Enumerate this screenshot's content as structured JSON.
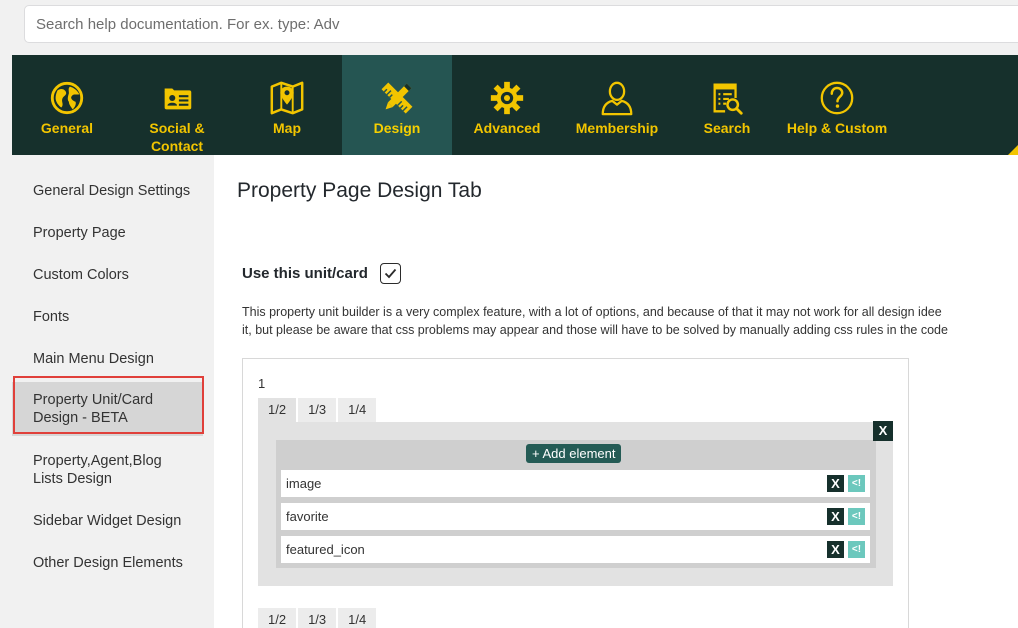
{
  "search": {
    "placeholder": "Search help documentation. For ex. type: Adv"
  },
  "nav": {
    "items": [
      {
        "label": "General",
        "icon": "globe-icon"
      },
      {
        "label": "Social &\nContact",
        "icon": "contact-card-icon"
      },
      {
        "label": "Map",
        "icon": "map-pin-icon"
      },
      {
        "label": "Design",
        "icon": "pencil-ruler-icon",
        "active": true
      },
      {
        "label": "Advanced",
        "icon": "gear-icon"
      },
      {
        "label": "Membership",
        "icon": "user-icon"
      },
      {
        "label": "Search",
        "icon": "search-list-icon"
      },
      {
        "label": "Help & Custom",
        "icon": "help-icon"
      }
    ]
  },
  "sidebar": {
    "items": [
      {
        "label": "General Design Settings"
      },
      {
        "label": "Property Page"
      },
      {
        "label": "Custom Colors"
      },
      {
        "label": "Fonts"
      },
      {
        "label": "Main Menu Design"
      },
      {
        "label": "Property Unit/Card Design - BETA",
        "active": true
      },
      {
        "label": "Property,Agent,Blog Lists Design"
      },
      {
        "label": "Sidebar Widget Design"
      },
      {
        "label": "Other Design Elements"
      }
    ]
  },
  "main": {
    "title": "Property Page Design Tab",
    "use_label": "Use this unit/card",
    "use_checked": true,
    "description_line1": "This property unit builder is a very complex feature, with a lot of options, and because of that it may not work for all design idee",
    "description_line2": "it, but please be aware that css problems may appear and those will have to be solved by manually adding css rules in the code"
  },
  "builder": {
    "row_number": "1",
    "column_tabs": [
      "1/2",
      "1/3",
      "1/4"
    ],
    "panel_close": "X",
    "add_element_label": "+ Add element",
    "elements": [
      "image",
      "favorite",
      "featured_icon"
    ],
    "element_remove": "X",
    "element_move": "<!"
  },
  "colors": {
    "nav_bg": "#16302c",
    "nav_active": "#255552",
    "nav_text": "#f2c500",
    "highlight": "#e0403a",
    "move_button": "#6cc8bd"
  }
}
